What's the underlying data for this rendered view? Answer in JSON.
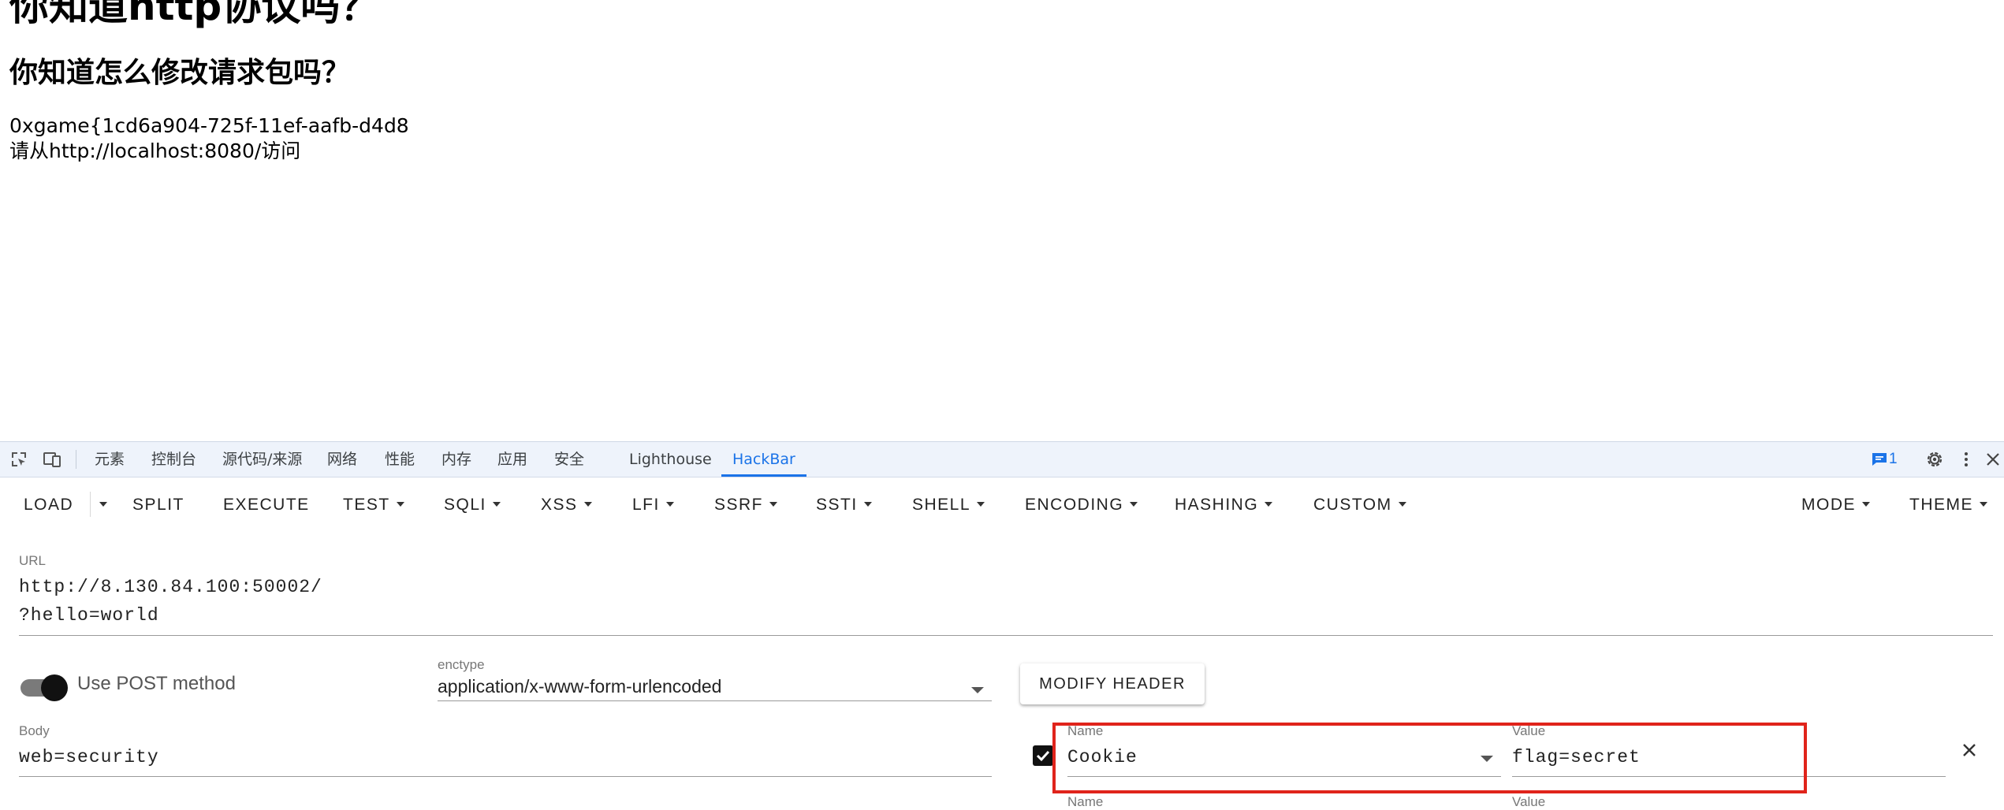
{
  "page": {
    "heading1": "你知道http协议吗？",
    "heading2": "你知道怎么修改请求包吗？",
    "flag_text": "0xgame{1cd6a904-725f-11ef-aafb-d4d8",
    "hint_text": "请从http://localhost:8080/访问"
  },
  "devtools": {
    "tabs": [
      "元素",
      "控制台",
      "源代码/来源",
      "网络",
      "性能",
      "内存",
      "应用",
      "安全",
      "Lighthouse",
      "HackBar"
    ],
    "active_tab": "HackBar",
    "issues_count": "1"
  },
  "hackbar": {
    "toolbar": {
      "load": "LOAD",
      "split": "SPLIT",
      "execute": "EXECUTE",
      "test": "TEST",
      "sqli": "SQLI",
      "xss": "XSS",
      "lfi": "LFI",
      "ssrf": "SSRF",
      "ssti": "SSTI",
      "shell": "SHELL",
      "encoding": "ENCODING",
      "hashing": "HASHING",
      "custom": "CUSTOM",
      "mode": "MODE",
      "theme": "THEME"
    },
    "url": {
      "label": "URL",
      "line1": "http://8.130.84.100:50002/",
      "line2": "?hello=world"
    },
    "post": {
      "toggle_label": "Use POST method",
      "enabled": true
    },
    "enctype": {
      "label": "enctype",
      "value": "application/x-www-form-urlencoded"
    },
    "modify_header": "MODIFY HEADER",
    "body": {
      "label": "Body",
      "value": "web=security"
    },
    "headers": [
      {
        "name_label": "Name",
        "name": "Cookie",
        "value_label": "Value",
        "value": "flag=secret",
        "checked": true
      },
      {
        "name_label": "Name",
        "name": "",
        "value_label": "Value",
        "value": ""
      }
    ]
  },
  "colors": {
    "accent": "#1a73e8",
    "highlight": "#e0241b"
  }
}
